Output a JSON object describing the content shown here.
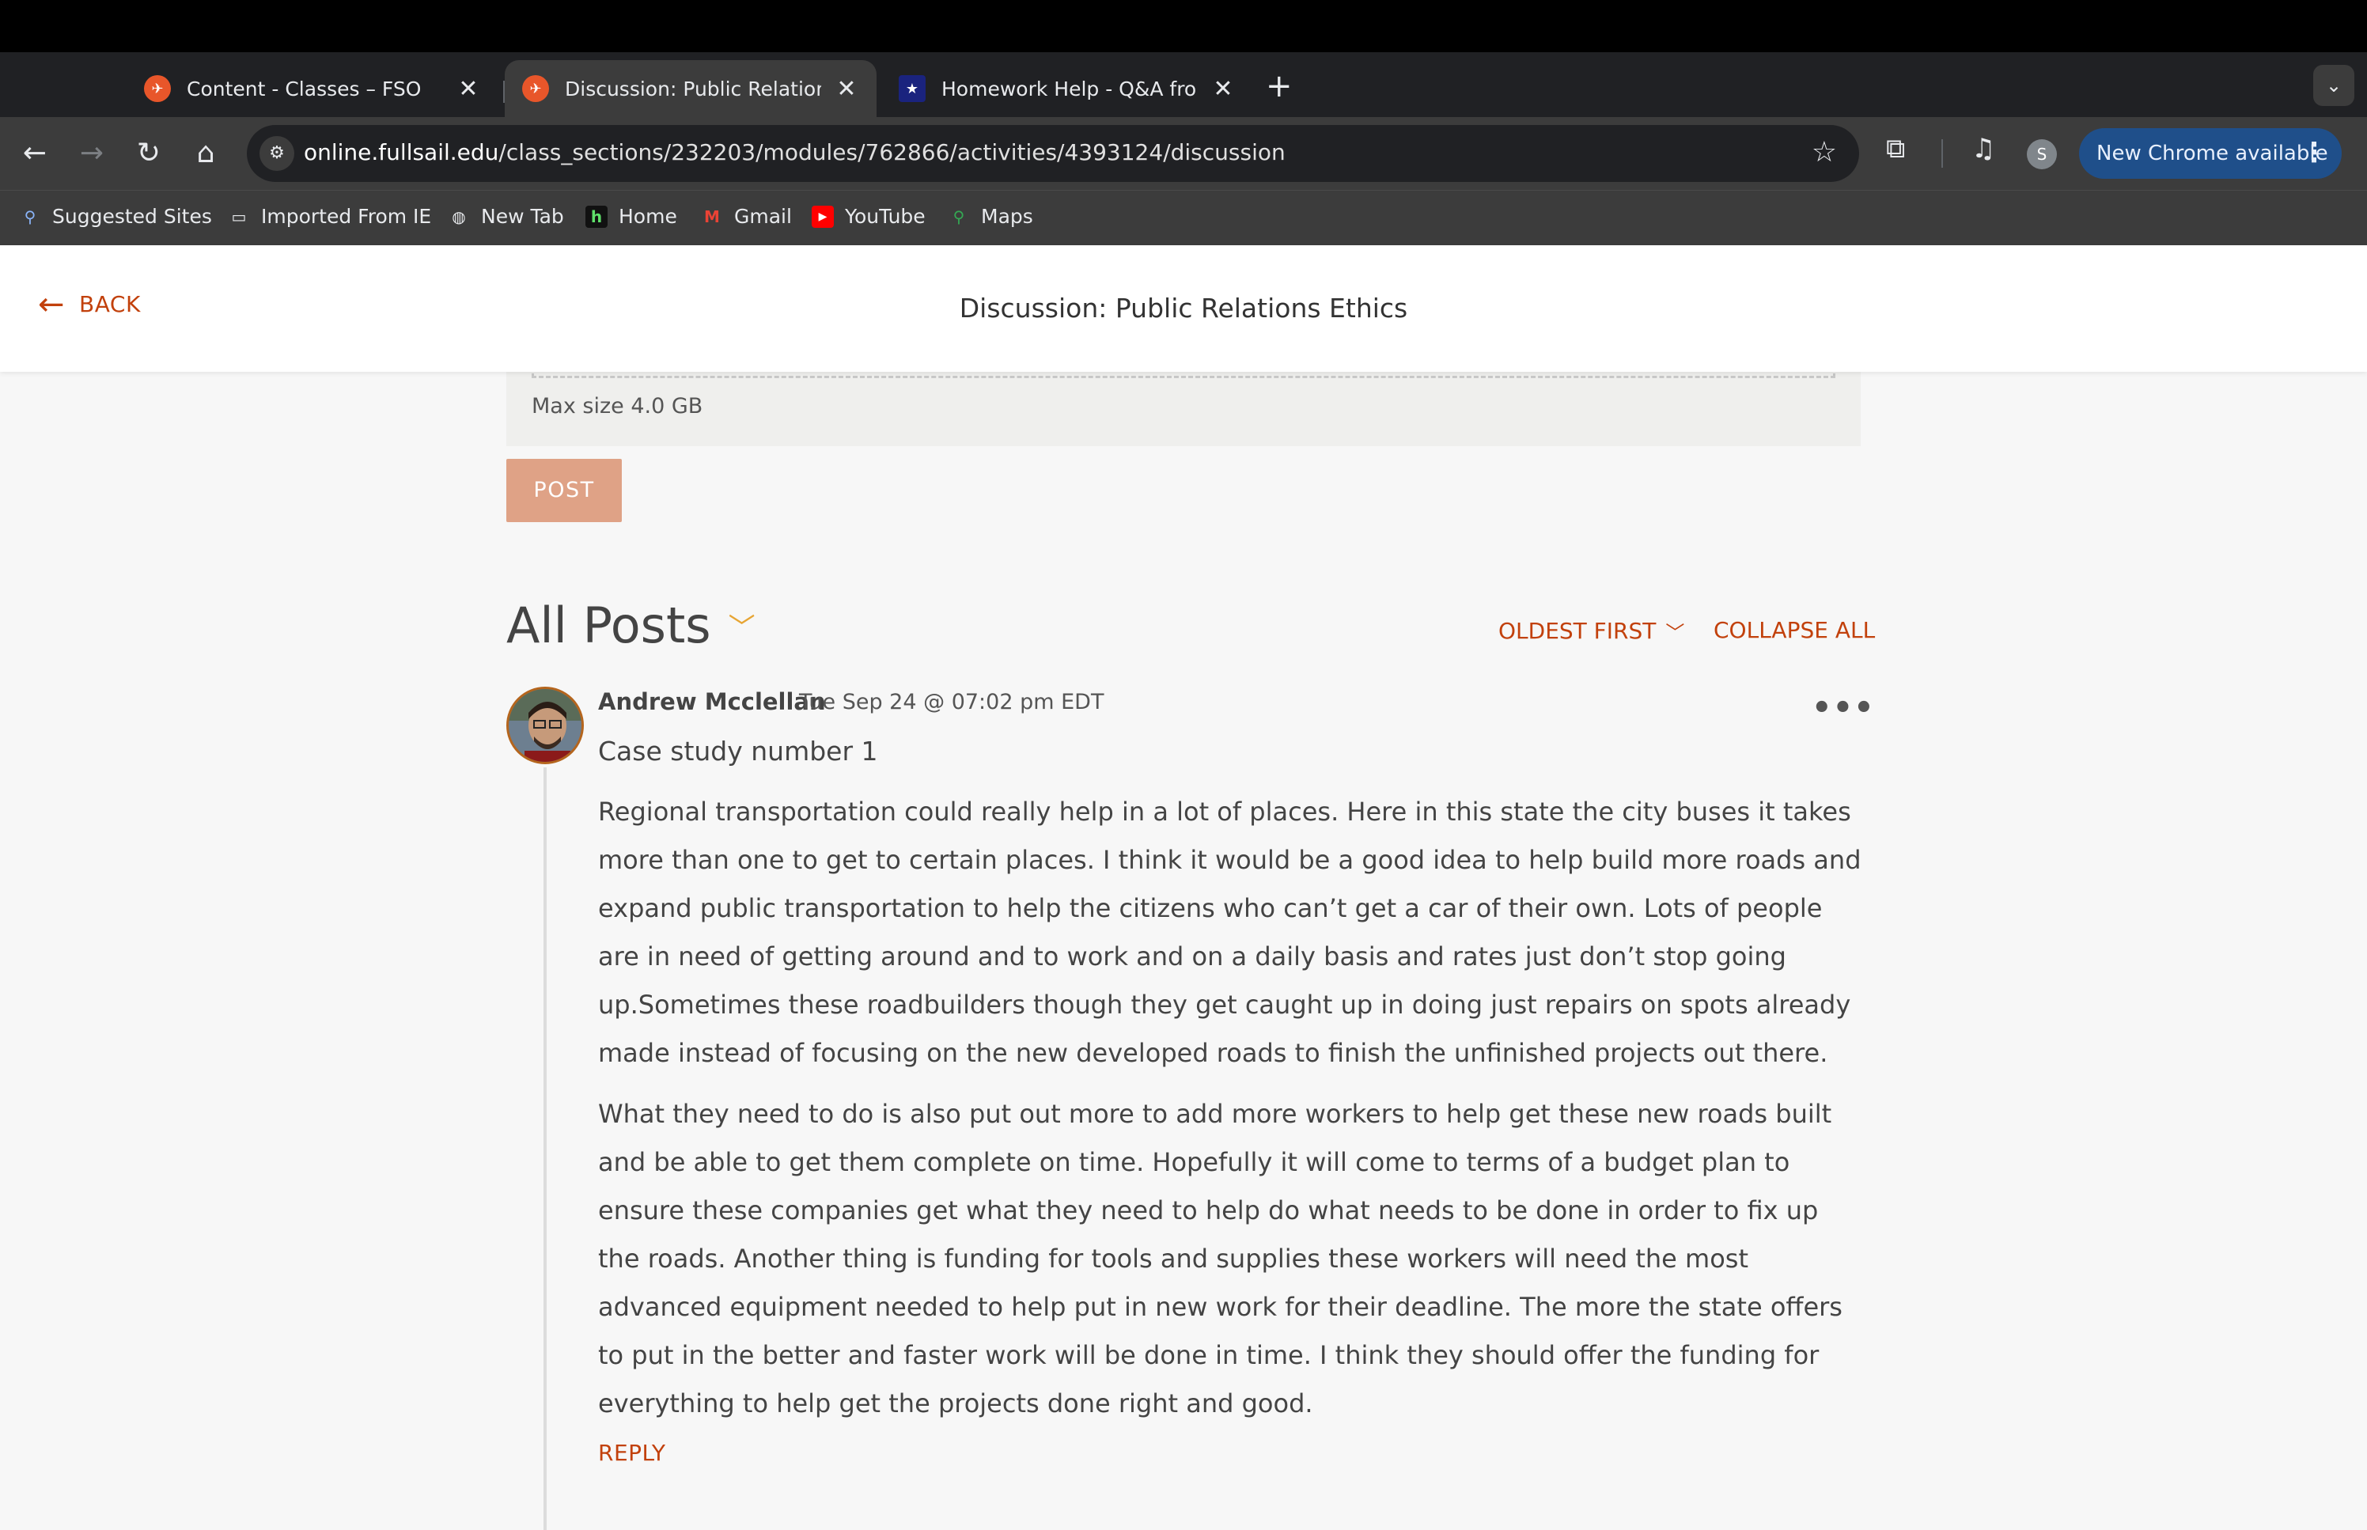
{
  "browser": {
    "tabs": [
      {
        "label": "Content - Classes – FSO",
        "close": "✕"
      },
      {
        "label": "Discussion: Public Relations E",
        "close": "✕"
      },
      {
        "label": "Homework Help - Q&A from C",
        "close": "✕"
      }
    ],
    "new_tab": "+",
    "url_host": "online.fullsail.edu",
    "url_path": "/class_sections/232203/modules/762866/activities/4393124/discussion",
    "profile_initial": "S",
    "new_chrome_label": "New Chrome available",
    "bookmarks": [
      {
        "label": "Suggested Sites"
      },
      {
        "label": "Imported From IE"
      },
      {
        "label": "New Tab"
      },
      {
        "label": "Home"
      },
      {
        "label": "Gmail"
      },
      {
        "label": "YouTube"
      },
      {
        "label": "Maps"
      }
    ]
  },
  "header": {
    "back_label": "BACK",
    "title": "Discussion: Public Relations Ethics"
  },
  "composer": {
    "max_size": "Max size 4.0 GB",
    "post_label": "POST"
  },
  "posts_section": {
    "title": "All Posts",
    "sort_label": "OLDEST FIRST",
    "collapse_label": "COLLAPSE ALL"
  },
  "post": {
    "author": "Andrew Mcclellan",
    "date": "Tue Sep 24 @ 07:02 pm EDT",
    "subject": "Case study number 1",
    "paragraphs": [
      "Regional transportation could really help in a lot of places. Here in this state the city buses it takes more than one to get to certain places. I think it would be a good idea to help build more roads and expand public transportation to help the citizens who can’t get a car of their own. Lots of people are in need of getting around and to work and on a daily basis and rates just don’t stop going up.Sometimes these roadbuilders though they get caught up in doing just repairs on spots already made instead of focusing on the new developed roads to finish the unfinished projects out there.",
      "What they need to do is also put out more to add more workers to help get these new roads built and be able to get them complete on time. Hopefully it will come to terms of a budget plan to ensure these companies get what they need to help do what needs to be done in order to fix up the roads. Another thing is funding for tools and supplies these workers will need the most advanced equipment needed to help put in new work for their deadline. The more the state offers to put in the better and faster work will be done in time. I think they should offer the funding for everything to help get the projects done right and good."
    ],
    "reply_label": "REPLY"
  },
  "colors": {
    "accent": "#c2410c",
    "post_button": "#dfa286",
    "chevron": "#e7a534",
    "new_chrome_bg": "#1f4f8a"
  }
}
